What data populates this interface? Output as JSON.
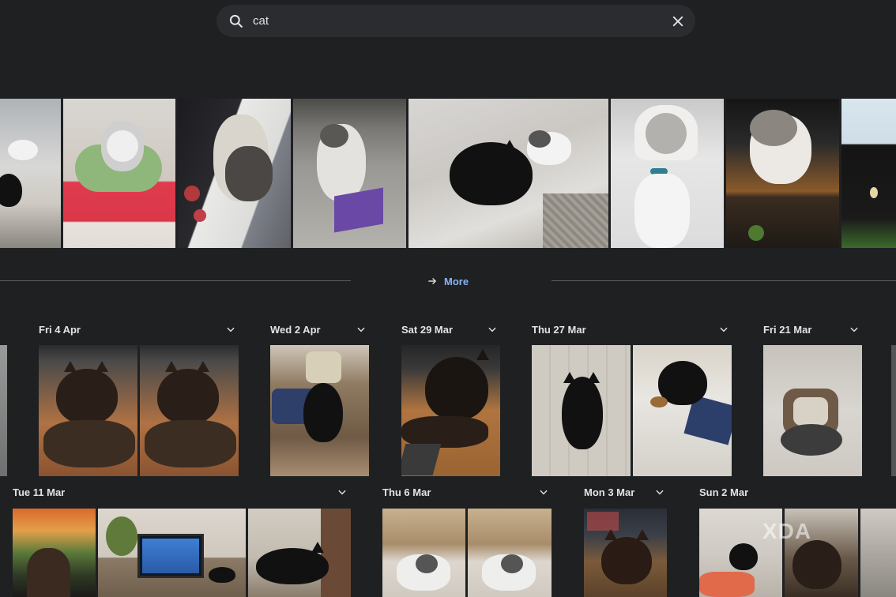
{
  "search": {
    "query": "cat",
    "search_icon": "search-icon",
    "clear_icon": "close-icon"
  },
  "more": {
    "label": "More",
    "icon": "arrow-right-icon",
    "color": "#8ab4f8"
  },
  "date_groups_row1": [
    {
      "label": "Fri 4 Apr"
    },
    {
      "label": "Wed 2 Apr"
    },
    {
      "label": "Sat 29 Mar"
    },
    {
      "label": "Thu 27 Mar"
    },
    {
      "label": "Fri 21 Mar"
    }
  ],
  "date_groups_row2": [
    {
      "label": "Tue 11 Mar"
    },
    {
      "label": "Thu 6 Mar"
    },
    {
      "label": "Mon 3 Mar"
    },
    {
      "label": "Sun 2 Mar"
    }
  ],
  "watermark": "XDA",
  "theme": {
    "background": "#1f2022",
    "search_bg": "#2b2c2f",
    "accent": "#8ab4f8"
  }
}
